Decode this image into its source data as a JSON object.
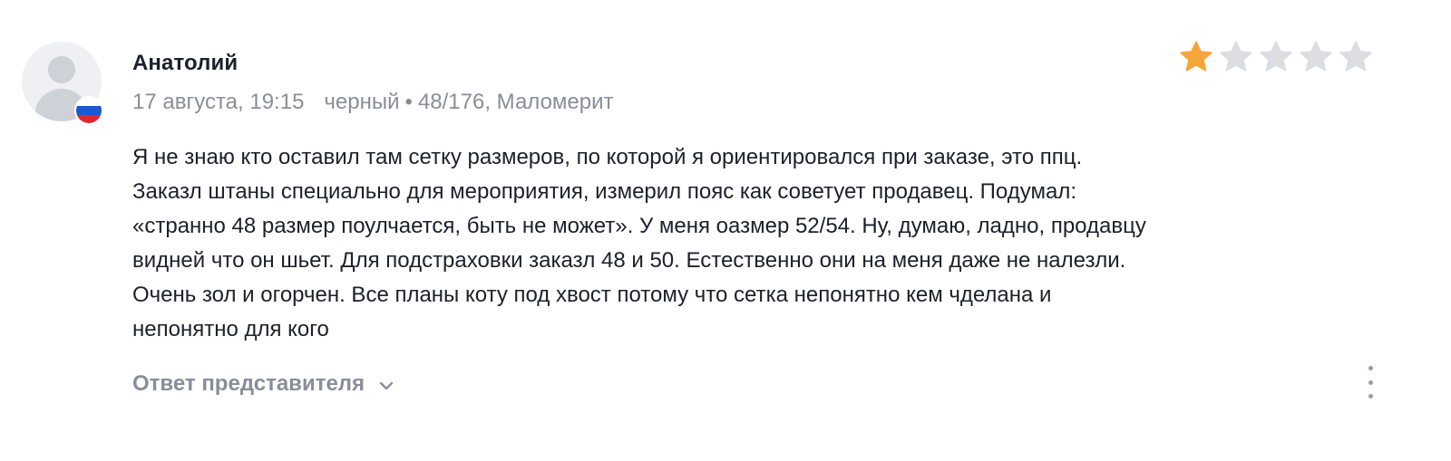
{
  "review": {
    "author": "Анатолий",
    "country_flag_colors": [
      "#ffffff",
      "#1c57d4",
      "#e0262f"
    ],
    "date": "17 августа, 19:15",
    "color": "черный",
    "separator": "•",
    "size_fit": "48/176, Маломерит",
    "rating": {
      "value": 1,
      "max": 5,
      "filled_color": "#f5a638",
      "empty_color": "#dcdde2"
    },
    "text_lines": [
      "Я не знаю кто оставил там сетку размеров, по которой я ориентировался при заказе, это ппц.",
      "Заказл штаны специально для мероприятия, измерил пояс как советует продавец. Подумал:",
      "«странно 48 размер поулчается, быть не может». У меня оазмер 52/54. Ну, думаю, ладно, продавцу",
      "видней что он шьет. Для подстраховки заказл 48 и 50. Естественно они на меня даже не налезли.",
      "Очень зол и огорчен. Все планы коту под хвост потому что сетка непонятно кем чделана и",
      "непонятно для кого"
    ],
    "reply_toggle_label": "Ответ представителя",
    "icons": {
      "avatar": "user-placeholder-icon",
      "flag": "russia-flag-icon",
      "star": "star-icon",
      "chevron": "chevron-down-icon",
      "more": "more-vertical-icon"
    }
  }
}
